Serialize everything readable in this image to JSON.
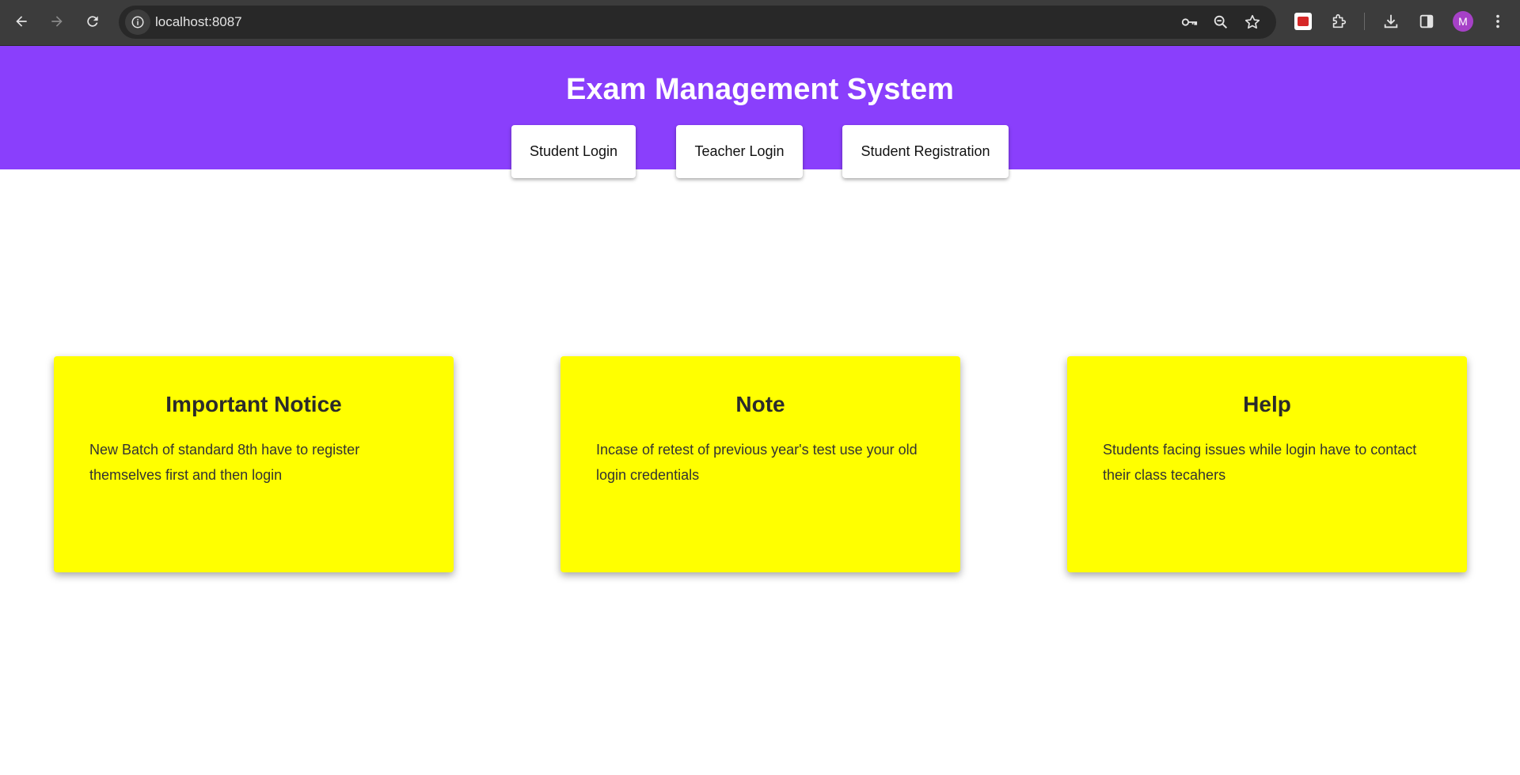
{
  "browser": {
    "url": "localhost:8087",
    "avatar_letter": "M",
    "icons": {
      "back": "arrow-left-icon",
      "forward": "arrow-right-icon",
      "reload": "reload-icon",
      "site_info": "info-icon",
      "password": "key-icon",
      "zoom": "zoom-icon",
      "bookmark": "star-icon",
      "extension_pinned": "red-extension-icon",
      "extensions": "puzzle-icon",
      "downloads": "download-icon",
      "side_panel": "side-panel-icon",
      "menu": "kebab-menu-icon"
    }
  },
  "header": {
    "title": "Exam Management System",
    "background": "#8a3ffc",
    "buttons": [
      {
        "label": "Student Login"
      },
      {
        "label": "Teacher Login"
      },
      {
        "label": "Student Registration"
      }
    ]
  },
  "cards": [
    {
      "title": "Important Notice",
      "text": "New Batch of standard 8th have to register themselves first and then login"
    },
    {
      "title": "Note",
      "text": "Incase of retest of previous year's test use your old login credentials"
    },
    {
      "title": "Help",
      "text": "Students facing issues while login have to contact their class tecahers"
    }
  ],
  "colors": {
    "card_background": "#ffff00",
    "chrome_background": "#3c3c3c"
  }
}
